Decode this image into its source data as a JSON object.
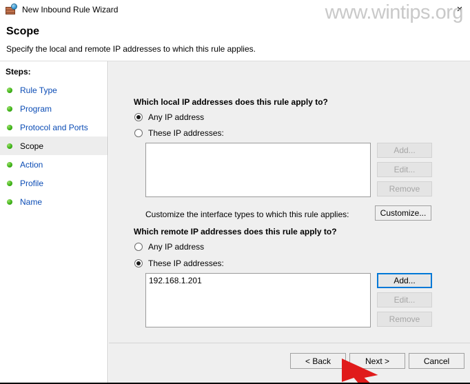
{
  "window": {
    "title": "New Inbound Rule Wizard",
    "icon": "firewall-globe-icon",
    "close_label": "×"
  },
  "watermark": {
    "text": "www.wintips.org"
  },
  "header": {
    "title": "Scope",
    "subtitle": "Specify the local and remote IP addresses to which this rule applies."
  },
  "sidebar": {
    "label": "Steps:",
    "items": [
      {
        "label": "Rule Type",
        "current": false
      },
      {
        "label": "Program",
        "current": false
      },
      {
        "label": "Protocol and Ports",
        "current": false
      },
      {
        "label": "Scope",
        "current": true
      },
      {
        "label": "Action",
        "current": false
      },
      {
        "label": "Profile",
        "current": false
      },
      {
        "label": "Name",
        "current": false
      }
    ]
  },
  "local_section": {
    "question": "Which local IP addresses does this rule apply to?",
    "radio_any": "Any IP address",
    "radio_these": "These IP addresses:",
    "selected": "any",
    "list_items": [],
    "buttons": {
      "add": "Add...",
      "edit": "Edit...",
      "remove": "Remove"
    }
  },
  "interface_row": {
    "text": "Customize the interface types to which this rule applies:",
    "button": "Customize..."
  },
  "remote_section": {
    "question": "Which remote IP addresses does this rule apply to?",
    "radio_any": "Any IP address",
    "radio_these": "These IP addresses:",
    "selected": "these",
    "list_items": [
      "192.168.1.201"
    ],
    "buttons": {
      "add": "Add...",
      "edit": "Edit...",
      "remove": "Remove"
    }
  },
  "footer": {
    "back": "< Back",
    "next": "Next >",
    "cancel": "Cancel"
  },
  "annotation": {
    "arrow_color": "#e01b1b",
    "points_at": "Next >"
  },
  "colors": {
    "link_blue": "#0b4cb5",
    "focus_blue": "#0078d7",
    "panel_gray": "#efefef",
    "bullet_green": "#3fb419"
  }
}
